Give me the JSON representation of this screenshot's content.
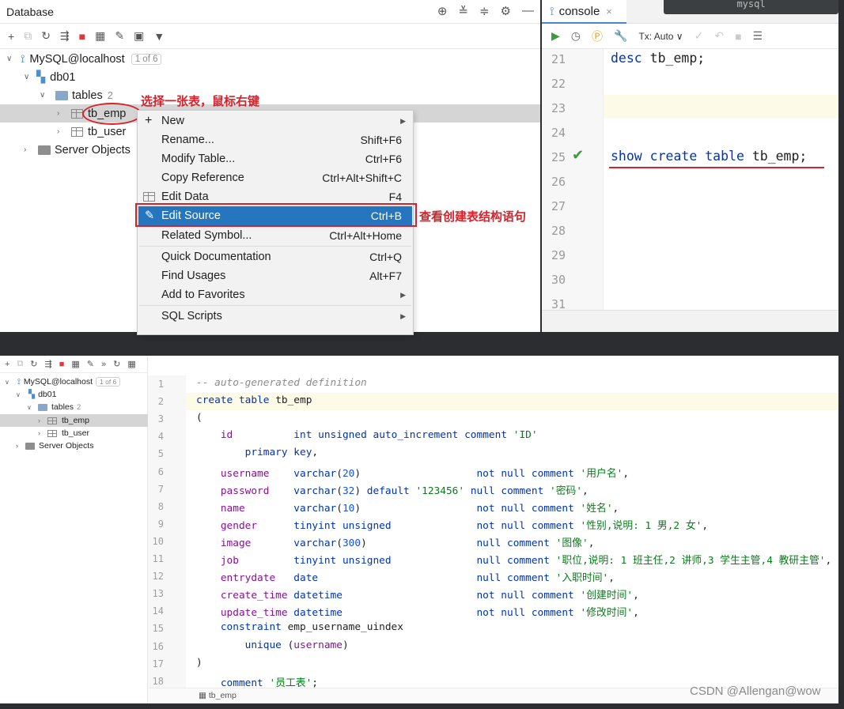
{
  "top_panel": {
    "title": "Database",
    "tree": {
      "datasource": "MySQL@localhost",
      "datasource_badge": "1 of 6",
      "schema": "db01",
      "tables_label": "tables",
      "tables_count": "2",
      "tables": [
        "tb_emp",
        "tb_user"
      ],
      "server_objects": "Server Objects"
    }
  },
  "context_menu": {
    "items": [
      {
        "label": "New",
        "shortcut": "",
        "submenu": true
      },
      {
        "label": "Rename...",
        "shortcut": "Shift+F6"
      },
      {
        "label": "Modify Table...",
        "shortcut": "Ctrl+F6"
      },
      {
        "label": "Copy Reference",
        "shortcut": "Ctrl+Alt+Shift+C"
      },
      {
        "label": "Edit Data",
        "shortcut": "F4"
      },
      {
        "label": "Edit Source",
        "shortcut": "Ctrl+B",
        "selected": true
      },
      {
        "label": "Related Symbol...",
        "shortcut": "Ctrl+Alt+Home"
      },
      {
        "label": "Quick Documentation",
        "shortcut": "Ctrl+Q"
      },
      {
        "label": "Find Usages",
        "shortcut": "Alt+F7"
      },
      {
        "label": "Add to Favorites",
        "shortcut": "",
        "submenu": true
      },
      {
        "label": "SQL Scripts",
        "shortcut": "",
        "submenu": true
      }
    ]
  },
  "annotations": {
    "right_click": "选择一张表，鼠标右键",
    "edit_source": "查看创建表结构语句"
  },
  "console": {
    "tab_label": "console",
    "tx_label": "Tx: Auto",
    "window_title": "mysql",
    "line_numbers": [
      "21",
      "22",
      "23",
      "24",
      "25",
      "26",
      "27",
      "28",
      "29",
      "30",
      "31"
    ],
    "line21": "desc tb_emp;",
    "line25": "show create table tb_emp;"
  },
  "bottom": {
    "tree": {
      "datasource": "MySQL@localhost",
      "badge": "1 of 6",
      "schema": "db01",
      "tables_label": "tables",
      "tables_count": "2",
      "tables": [
        "tb_emp",
        "tb_user"
      ],
      "server_objects": "Server Objects"
    },
    "line_numbers": [
      "1",
      "2",
      "3",
      "4",
      "5",
      "6",
      "7",
      "8",
      "9",
      "10",
      "11",
      "12",
      "13",
      "14",
      "15",
      "16",
      "17",
      "18"
    ],
    "code": {
      "l1": "-- auto-generated definition",
      "l2": "create table tb_emp",
      "l3": "(",
      "l4": "    id          int unsigned auto_increment comment 'ID'",
      "l5": "        primary key,",
      "l6": "    username    varchar(20)                   not null comment '用户名',",
      "l7": "    password    varchar(32) default '123456' null comment '密码',",
      "l8": "    name        varchar(10)                   not null comment '姓名',",
      "l9": "    gender      tinyint unsigned              not null comment '性别,说明: 1 男,2 女',",
      "l10": "    image       varchar(300)                  null comment '图像',",
      "l11": "    job         tinyint unsigned              null comment '职位,说明: 1 班主任,2 讲师,3 学生主管,4 教研主管',",
      "l12": "    entrydate   date                          null comment '入职时间',",
      "l13": "    create_time datetime                      not null comment '创建时间',",
      "l14": "    update_time datetime                      not null comment '修改时间',",
      "l15": "    constraint emp_username_uindex",
      "l16": "        unique (username)",
      "l17": ")",
      "l18": "    comment '员工表';"
    },
    "breadcrumb": "tb_emp"
  },
  "watermark": "CSDN @Allengan@wow"
}
